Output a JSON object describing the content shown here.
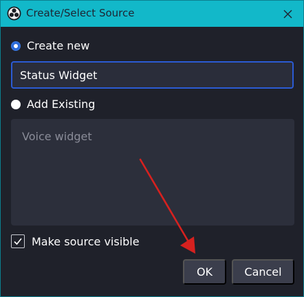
{
  "window": {
    "title": "Create/Select Source",
    "title_bar_color": "#12b8c9",
    "background_color": "#1f212a",
    "app_icon": "obs-logo-icon",
    "close_icon": "close-icon"
  },
  "create_new": {
    "label": "Create new",
    "selected": true
  },
  "name_input": {
    "value": "Status Widget"
  },
  "add_existing": {
    "label": "Add Existing",
    "selected": false
  },
  "existing_sources": {
    "items": [
      "Voice widget"
    ]
  },
  "visibility": {
    "label": "Make source visible",
    "checked": true
  },
  "buttons": {
    "ok_label": "OK",
    "cancel_label": "Cancel"
  },
  "annotation": {
    "arrow_color": "#d6211f",
    "arrow_icon": "red-arrow-pointer"
  },
  "accent_color": "#2b5bd4"
}
